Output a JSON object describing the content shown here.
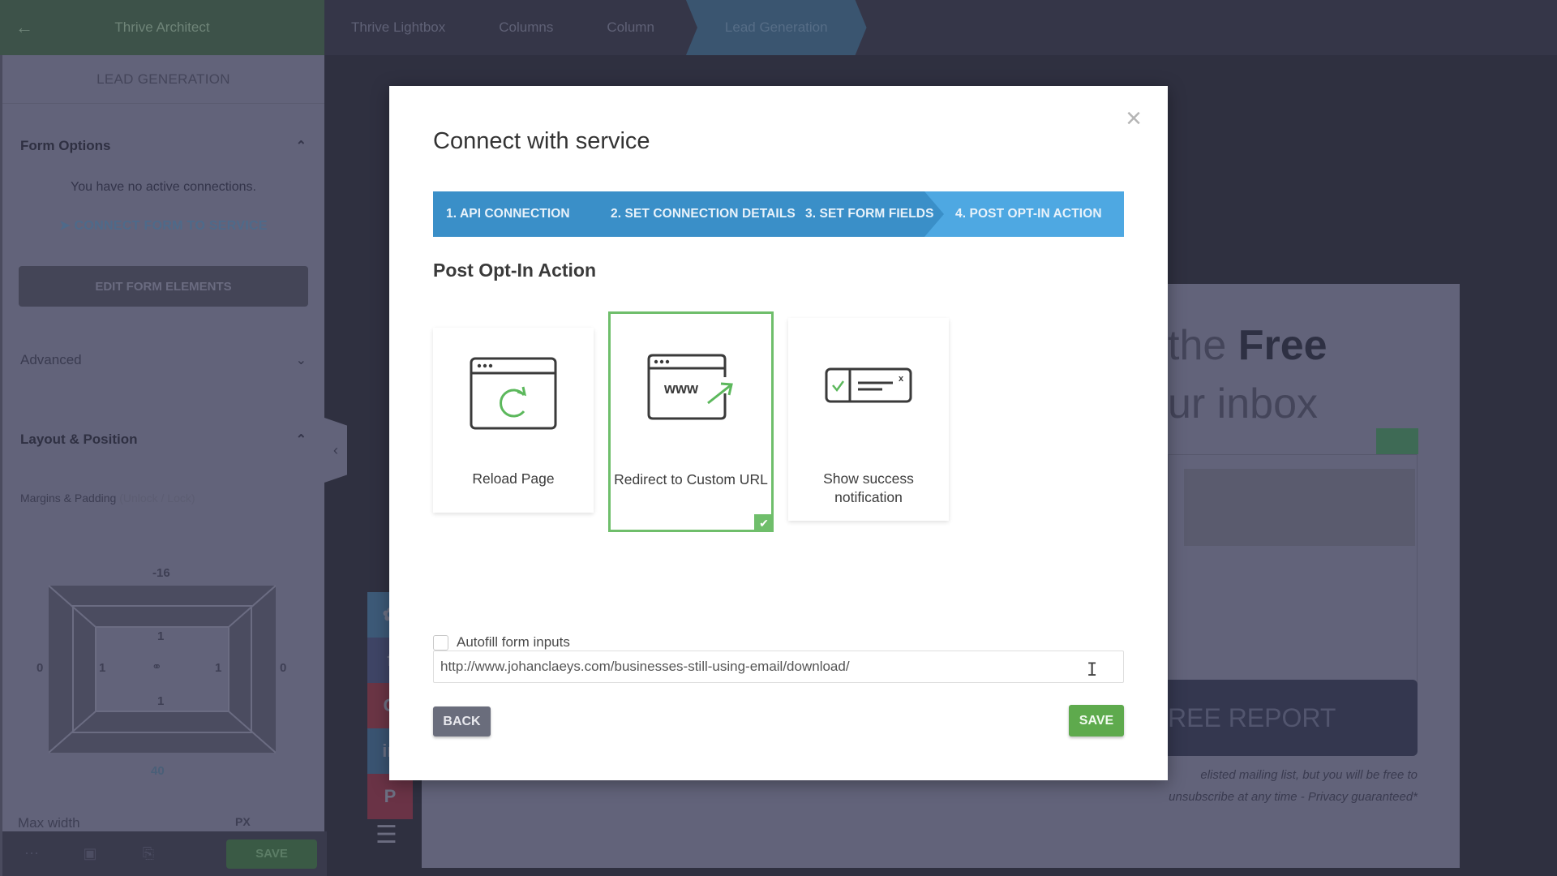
{
  "topbar": {
    "back_icon": "arrow-left-icon",
    "brand": "Thrive Architect",
    "breadcrumbs": [
      "Thrive Lightbox",
      "Columns",
      "Column",
      "Lead Generation"
    ]
  },
  "sidebar": {
    "header": "LEAD GENERATION",
    "form_options": {
      "title": "Form Options",
      "no_connections": "You have no active connections.",
      "connect_link": "CONNECT FORM TO SERVICE",
      "edit_button": "EDIT FORM ELEMENTS"
    },
    "advanced": {
      "title": "Advanced"
    },
    "layout": {
      "title": "Layout & Position",
      "margins_label": "Margins & Padding",
      "margins_hint": "(Unlock / Lock)",
      "values": {
        "margin_top": "-16",
        "padding_top": "1",
        "margin_left": "0",
        "padding_left": "1",
        "padding_right": "1",
        "margin_right": "0",
        "padding_bottom": "1",
        "margin_bottom": "40"
      },
      "max_width_label": "Max width",
      "max_width_unit": "PX"
    },
    "bottom_bar": {
      "save": "SAVE"
    }
  },
  "page_bg": {
    "headline_line1_light": "the ",
    "headline_line1_bold": "Free",
    "headline_line2": "ur inbox",
    "report_button": "REE REPORT",
    "legal_line1": "elisted mailing list, but you will be free to",
    "legal_line2": "unsubscribe at any time - Privacy guaranteed*"
  },
  "modal": {
    "title": "Connect with service",
    "close_icon": "close-icon",
    "steps": [
      {
        "label": "1. API CONNECTION",
        "active": false
      },
      {
        "label": "2. SET CONNECTION DETAILS",
        "active": false
      },
      {
        "label": "3. SET FORM FIELDS",
        "active": false
      },
      {
        "label": "4. POST OPT-IN ACTION",
        "active": true
      }
    ],
    "section_title": "Post Opt-In Action",
    "options": [
      {
        "label": "Reload Page",
        "icon": "reload-page-icon",
        "selected": false
      },
      {
        "label": "Redirect to Custom URL",
        "icon": "redirect-url-icon",
        "selected": true
      },
      {
        "label": "Show success notification",
        "icon": "success-notification-icon",
        "selected": false
      }
    ],
    "autofill_label": "Autofill form inputs",
    "autofill_checked": false,
    "url_value": "http://www.johanclaeys.com/businesses-still-using-email/download/",
    "back_button": "BACK",
    "save_button": "SAVE"
  },
  "colors": {
    "step_bar": "#3a8fc8",
    "step_active": "#4ea8e2",
    "selected_green": "#6fbe6b",
    "save_green": "#5eaa4d",
    "back_gray": "#6a6d7c"
  }
}
